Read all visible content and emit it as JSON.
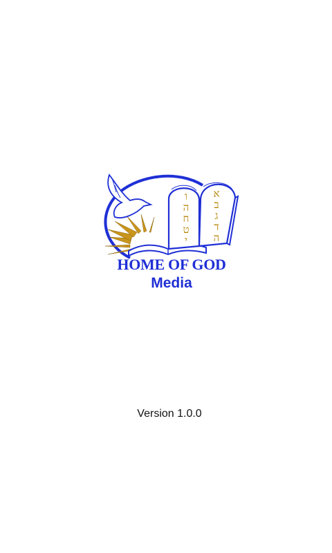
{
  "splash": {
    "logo": {
      "icon": "home-of-god-logo",
      "tablet_left_letters": "ו ה ח ט י",
      "tablet_right_letters": "א ב ג ד ה",
      "title": "HOME OF GOD",
      "subtitle": "Media"
    },
    "version": "Version 1.0.0"
  },
  "colors": {
    "brand_blue": "#1f2fd6",
    "gold": "#b8860b",
    "background": "#ffffff"
  }
}
